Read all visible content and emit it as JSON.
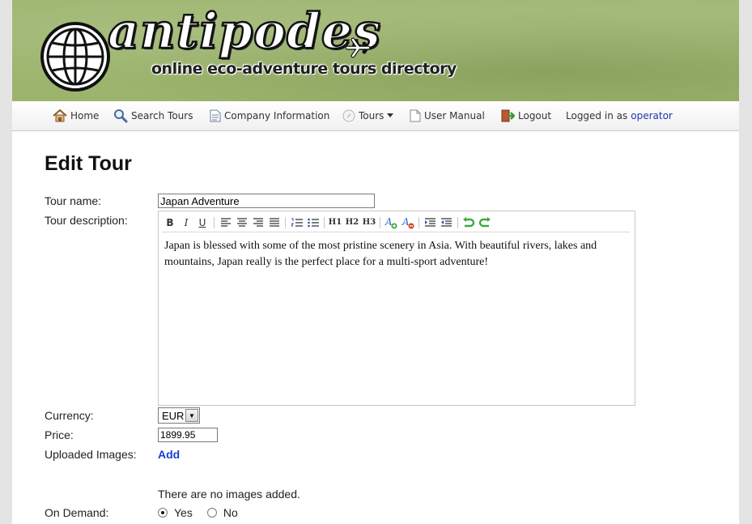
{
  "header": {
    "logo_text": "antipodes",
    "tagline": "online eco-adventure tours directory"
  },
  "nav": {
    "items": [
      {
        "label": "Home",
        "icon": "home-icon"
      },
      {
        "label": "Search Tours",
        "icon": "search-icon"
      },
      {
        "label": "Company Information",
        "icon": "document-icon"
      },
      {
        "label": "Tours",
        "icon": "compass-icon"
      },
      {
        "label": "User Manual",
        "icon": "manual-icon"
      },
      {
        "label": "Logout",
        "icon": "logout-icon"
      }
    ],
    "logged_in_text": "Logged in as",
    "username": "operator"
  },
  "page": {
    "title": "Edit Tour"
  },
  "form": {
    "tour_name_label": "Tour name:",
    "tour_name_value": "Japan Adventure",
    "description_label": "Tour description:",
    "description_text": "Japan is blessed with some of the most pristine scenery in Asia. With beautiful rivers, lakes and mountains, Japan really is the perfect place for a multi-sport adventure!",
    "toolbar": {
      "bold": "B",
      "italic": "I",
      "underline": "U",
      "h1": "H1",
      "h2": "H2",
      "h3": "H3"
    },
    "currency_label": "Currency:",
    "currency_value": "EUR",
    "price_label": "Price:",
    "price_value": "1899.95",
    "images_label": "Uploaded Images:",
    "add_link": "Add",
    "no_images_text": "There are no images added.",
    "on_demand_label": "On Demand:",
    "on_demand_options": [
      "Yes",
      "No"
    ],
    "on_demand_selected": "Yes"
  },
  "colors": {
    "banner": "#9cb46d",
    "link": "#1a3fd0",
    "username": "#2233aa"
  }
}
